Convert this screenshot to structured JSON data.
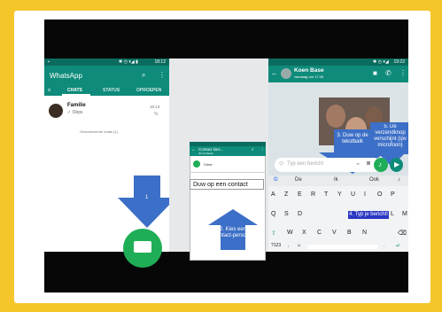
{
  "left_phone": {
    "status_time": "18:12",
    "app_title": "WhatsApp",
    "tabs": [
      "CHATS",
      "STATUS",
      "OPROEPEN"
    ],
    "chat": {
      "name": "Familie",
      "last_message": "✓ Oeps",
      "time": "18:13",
      "mute_icon": "%"
    },
    "archived": "Gearchiveerde chats (1)"
  },
  "middle": {
    "header": "Contact kiez...",
    "header_sub": "30 contacten",
    "contact": "Crine",
    "caption_box": "Duw op een contact"
  },
  "right_phone": {
    "status_time": "19:22",
    "contact_name": "Koen Base",
    "last_seen": "vandaag om 17:26",
    "input_placeholder": "Typ een bericht",
    "suggestions": [
      "De",
      "Ik",
      "Ook"
    ],
    "keyboard_row1": [
      "A",
      "Z",
      "E",
      "R",
      "T",
      "Y",
      "U",
      "I",
      "O",
      "P"
    ],
    "keyboard_row2_left": [
      "Q",
      "S",
      "D"
    ],
    "keyboard_highlight": "4. Typ je bericht!",
    "keyboard_row2_right": [
      "K",
      "L",
      "M"
    ],
    "keyboard_row3": [
      "W",
      "X",
      "C",
      "V",
      "B",
      "N"
    ],
    "key_123": "?123"
  },
  "overlays": {
    "step1": "1",
    "step2": "2. Kies een contact-persoon",
    "step3": "3. Duw op de tekstbalk",
    "step5": "5. De verzendknop verschijnt (ipv microfoon)"
  },
  "colors": {
    "frame": "#f5c62a",
    "whatsapp_dark": "#0b6b5e",
    "whatsapp_teal": "#0e8b7a",
    "whatsapp_green": "#1fae57",
    "overlay_blue": "#3c6fc7"
  }
}
